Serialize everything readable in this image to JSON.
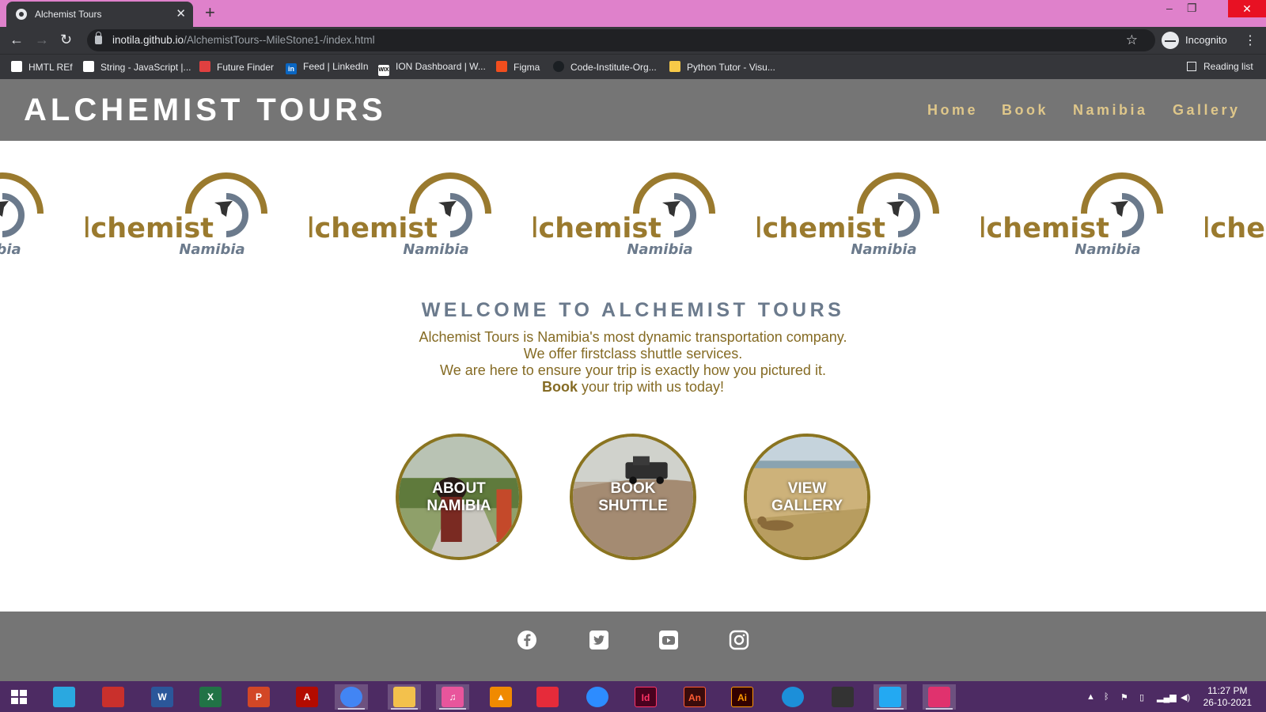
{
  "browser": {
    "tab_title": "Alchemist Tours",
    "url_domain": "inotila.github.io",
    "url_path": "/AlchemistTours--MileStone1-/index.html",
    "profile_label": "Incognito",
    "bookmarks": [
      {
        "label": "HMTL REf",
        "icon_color": "#ffffff"
      },
      {
        "label": "String - JavaScript |...",
        "icon_color": "#ffffff"
      },
      {
        "label": "Future Finder",
        "icon_color": "#e04040"
      },
      {
        "label": "Feed | LinkedIn",
        "icon_color": "#0a66c2"
      },
      {
        "label": "ION Dashboard | W...",
        "icon_color": "#ffffff"
      },
      {
        "label": "Figma",
        "icon_color": "#f24e1e"
      },
      {
        "label": "Code-Institute-Org...",
        "icon_color": "#1b1f23"
      },
      {
        "label": "Python Tutor - Visu...",
        "icon_color": "#f7c948"
      }
    ],
    "reading_list_label": "Reading list"
  },
  "site": {
    "brand": "ALCHEMIST TOURS",
    "nav": [
      {
        "label": "Home",
        "active": true
      },
      {
        "label": "Book",
        "active": false
      },
      {
        "label": "Namibia",
        "active": false
      },
      {
        "label": "Gallery",
        "active": false
      }
    ],
    "logo_word": "alchemist",
    "logo_sub": "Namibia",
    "welcome_heading": "WELCOME TO ALCHEMIST TOURS",
    "intro_lines": [
      "Alchemist Tours is Namibia's most dynamic transportation company.",
      "We offer firstclass shuttle services.",
      "We are here to ensure your trip is exactly how you pictured it."
    ],
    "intro_book_bold": "Book",
    "intro_book_rest": " your trip with us today!",
    "circles": [
      {
        "line1": "ABOUT",
        "line2": "NAMIBIA"
      },
      {
        "line1": "BOOK",
        "line2": "SHUTTLE"
      },
      {
        "line1": "VIEW",
        "line2": "GALLERY"
      }
    ],
    "social": [
      "facebook-icon",
      "twitter-icon",
      "youtube-icon",
      "instagram-icon"
    ]
  },
  "taskbar": {
    "apps": [
      {
        "name": "windows-start-icon",
        "letter": "",
        "color": "#4d2b63"
      },
      {
        "name": "sync-app-icon",
        "letter": "",
        "color": "#2aa8e0"
      },
      {
        "name": "red-app-icon",
        "letter": "",
        "color": "#c9302c"
      },
      {
        "name": "word-icon",
        "letter": "W",
        "color": "#2b579a"
      },
      {
        "name": "excel-icon",
        "letter": "X",
        "color": "#217346"
      },
      {
        "name": "powerpoint-icon",
        "letter": "P",
        "color": "#d24726"
      },
      {
        "name": "acrobat-icon",
        "letter": "A",
        "color": "#b30b00"
      },
      {
        "name": "chrome-icon",
        "letter": "",
        "color": "#4285f4"
      },
      {
        "name": "file-explorer-icon",
        "letter": "",
        "color": "#f3c14c"
      },
      {
        "name": "itunes-icon",
        "letter": "♫",
        "color": "#e8559c"
      },
      {
        "name": "vlc-icon",
        "letter": "▲",
        "color": "#f08a00"
      },
      {
        "name": "media-app-icon",
        "letter": "",
        "color": "#e62b3a"
      },
      {
        "name": "zoom-icon",
        "letter": "",
        "color": "#2d8cff"
      },
      {
        "name": "indesign-icon",
        "letter": "Id",
        "color": "#49021f"
      },
      {
        "name": "animate-icon",
        "letter": "An",
        "color": "#3a0b0b"
      },
      {
        "name": "illustrator-icon",
        "letter": "Ai",
        "color": "#330000"
      },
      {
        "name": "edge-icon",
        "letter": "",
        "color": "#1c8fd9"
      },
      {
        "name": "pen-app-icon",
        "letter": "",
        "color": "#333333"
      },
      {
        "name": "vscode-icon",
        "letter": "",
        "color": "#23a9f2"
      },
      {
        "name": "creative-cloud-icon",
        "letter": "",
        "color": "#e0326e"
      }
    ],
    "time": "11:27 PM",
    "date": "26-10-2021"
  },
  "colors": {
    "gold": "#9a7a2e",
    "slate": "#6b7a8c",
    "header_gray": "#757575",
    "nav_gold": "#dfc78a"
  }
}
